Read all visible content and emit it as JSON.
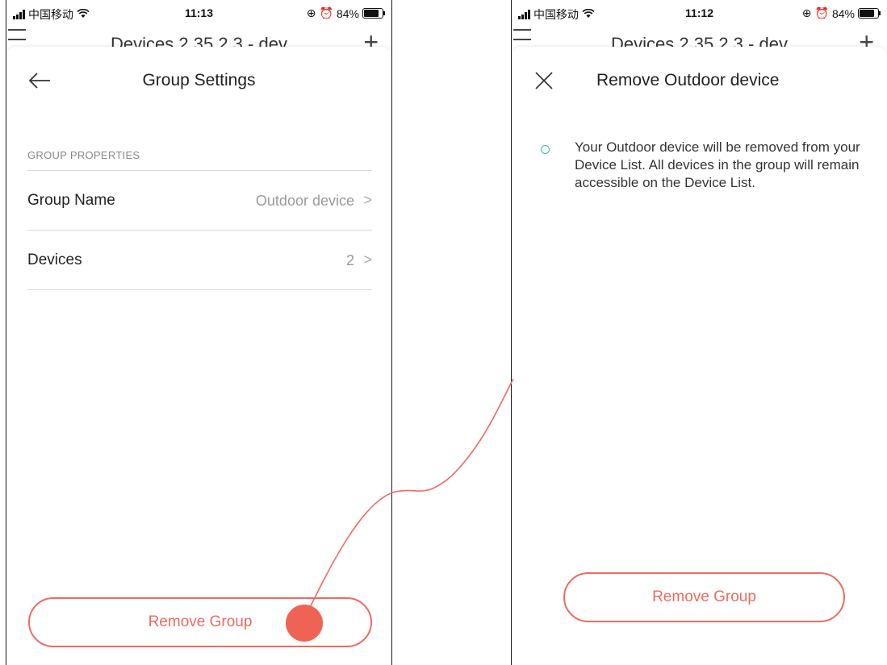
{
  "left_screen": {
    "status": {
      "carrier": "中国移动",
      "time": "11:13",
      "battery": "84%"
    },
    "behind_title": "Devices 2.35.2.3 - dev",
    "title": "Group Settings",
    "section_label": "GROUP PROPERTIES",
    "rows": [
      {
        "label": "Group Name",
        "value": "Outdoor device"
      },
      {
        "label": "Devices",
        "value": "2"
      }
    ],
    "chevron": ">",
    "remove_button": "Remove Group"
  },
  "right_screen": {
    "status": {
      "carrier": "中国移动",
      "time": "11:12",
      "battery": "84%"
    },
    "behind_title": "Devices 2.35.2.3 - dev",
    "title": "Remove Outdoor device",
    "message": "Your Outdoor device will be removed from your Device List. All devices in the group will remain accessible on the Device List.",
    "remove_button": "Remove Group"
  },
  "colors": {
    "accent": "#ef6a5f",
    "notice_dot": "#2fbfae",
    "divider": "#d8d8d8"
  },
  "icons": {
    "back": "left-arrow-icon",
    "close": "close-icon",
    "menu": "hamburger-icon",
    "add": "plus-icon",
    "chevron": "chevron-right-icon"
  }
}
